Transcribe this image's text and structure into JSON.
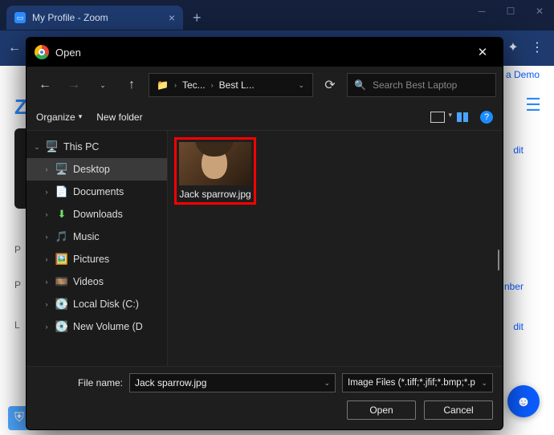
{
  "browser": {
    "tab_title": "My Profile - Zoom",
    "bg_logo": "Z",
    "demo_link": "a Demo",
    "edit": "dit",
    "nber": "nber",
    "p_label": "P",
    "l_label": "L"
  },
  "dialog": {
    "title": "Open",
    "path": {
      "seg1": "Tec...",
      "seg2": "Best L..."
    },
    "search_placeholder": "Search Best Laptop",
    "toolbar": {
      "organize": "Organize",
      "new_folder": "New folder"
    },
    "tree": {
      "this_pc": "This PC",
      "desktop": "Desktop",
      "documents": "Documents",
      "downloads": "Downloads",
      "music": "Music",
      "pictures": "Pictures",
      "videos": "Videos",
      "local_disk": "Local Disk (C:)",
      "new_volume": "New Volume (D"
    },
    "file": {
      "name": "Jack sparrow.jpg"
    },
    "footer": {
      "file_name_label": "File name:",
      "file_name_value": "Jack sparrow.jpg",
      "filter": "Image Files (*.tiff;*.jfif;*.bmp;*.p",
      "open": "Open",
      "cancel": "Cancel"
    }
  }
}
